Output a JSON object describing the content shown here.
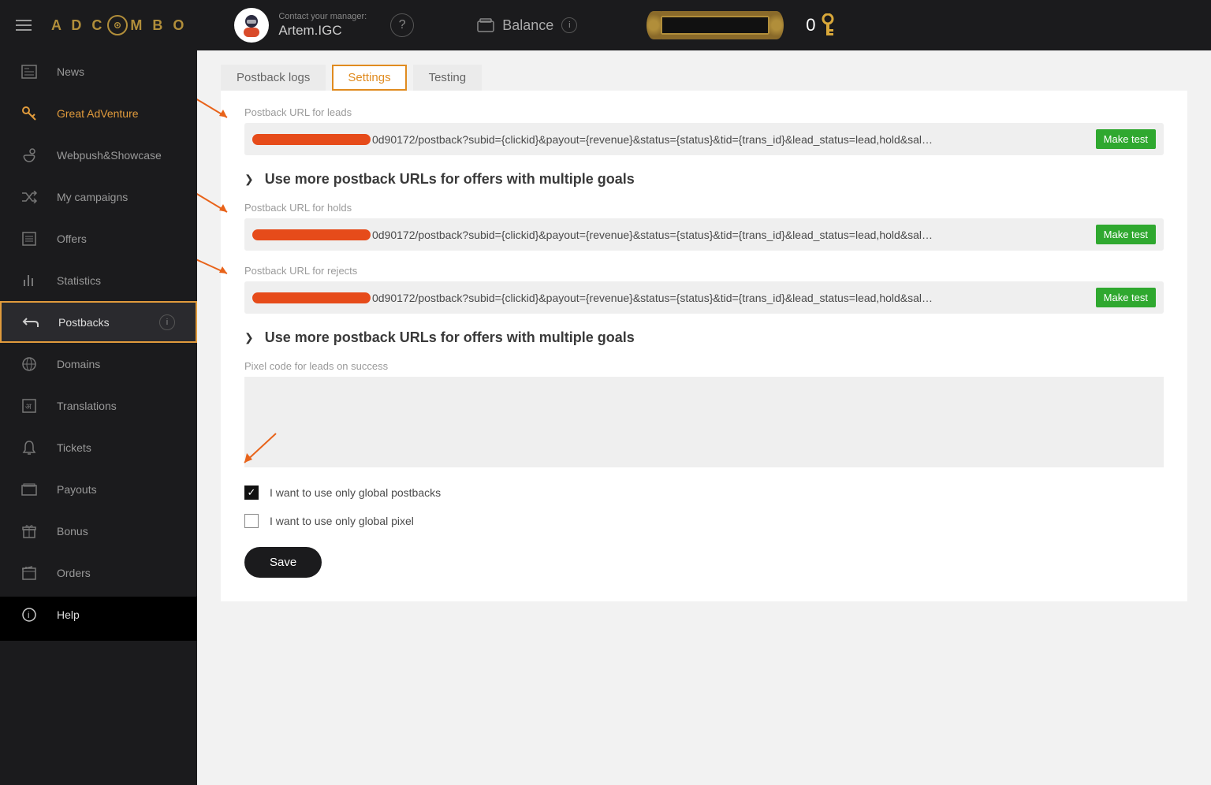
{
  "header": {
    "logo_text_left": "A D C",
    "logo_text_right": "M B O",
    "manager_label": "Contact your manager:",
    "manager_name": "Artem.IGC",
    "balance_label": "Balance",
    "key_amount": "0"
  },
  "sidebar": {
    "items": [
      {
        "label": "News"
      },
      {
        "label": "Great AdVenture"
      },
      {
        "label": "Webpush&Showcase"
      },
      {
        "label": "My campaigns"
      },
      {
        "label": "Offers"
      },
      {
        "label": "Statistics"
      },
      {
        "label": "Postbacks"
      },
      {
        "label": "Domains"
      },
      {
        "label": "Translations"
      },
      {
        "label": "Tickets"
      },
      {
        "label": "Payouts"
      },
      {
        "label": "Bonus"
      },
      {
        "label": "Orders"
      },
      {
        "label": "Help"
      }
    ]
  },
  "tabs": {
    "postback_logs": "Postback logs",
    "settings": "Settings",
    "testing": "Testing"
  },
  "settings": {
    "url_leads_label": "Postback URL for leads",
    "url_holds_label": "Postback URL for holds",
    "url_rejects_label": "Postback URL for rejects",
    "url_value": "0d90172/postback?subid={clickid}&payout={revenue}&status={status}&tid={trans_id}&lead_status=lead,hold&sal…",
    "make_test": "Make test",
    "expander_text": "Use more postback URLs for offers with multiple goals",
    "pixel_label": "Pixel code for leads on success",
    "cb_global_postbacks": "I want to use only global postbacks",
    "cb_global_pixel": "I want to use only global pixel",
    "save": "Save"
  }
}
